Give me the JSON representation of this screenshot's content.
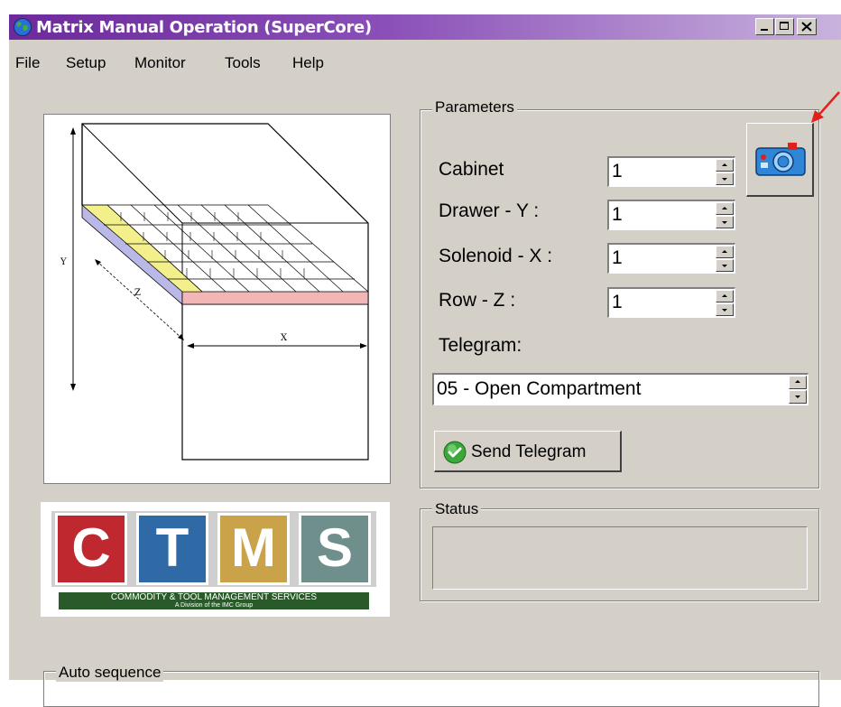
{
  "window": {
    "title": "Matrix Manual Operation (SuperCore)",
    "caption_buttons": [
      "minimize",
      "maximize",
      "close"
    ]
  },
  "menu": [
    "File",
    "Setup",
    "Monitor",
    "Tools",
    "Help"
  ],
  "diagram": {
    "label_y": "Y",
    "label_z": "Z",
    "label_x": "X"
  },
  "parameters": {
    "group_label": "Parameters",
    "cabinet": {
      "label": "Cabinet",
      "value": "1"
    },
    "drawer": {
      "label": "Drawer - Y :",
      "value": "1"
    },
    "solenoid": {
      "label": "Solenoid - X :",
      "value": "1"
    },
    "row": {
      "label": "Row - Z :",
      "value": "1"
    },
    "telegram_label": "Telegram:",
    "telegram_value": "05 - Open Compartment",
    "send_label": "Send Telegram"
  },
  "camera_button": {
    "icon": "camera-icon"
  },
  "logo": {
    "letters": [
      "C",
      "T",
      "M",
      "S"
    ],
    "colors": [
      "#c0282f",
      "#2f6aa6",
      "#c9a24a",
      "#6f8f8c"
    ],
    "tagline": "COMMODITY & TOOL MANAGEMENT SERVICES",
    "subline": "A Division of the IMC Group"
  },
  "status": {
    "group_label": "Status",
    "text": ""
  },
  "auto_sequence": {
    "group_label": "Auto sequence"
  },
  "colors": {
    "title_start": "#6c2a9c",
    "face": "#d4d0c8",
    "annotation_arrow": "#e0201a"
  }
}
